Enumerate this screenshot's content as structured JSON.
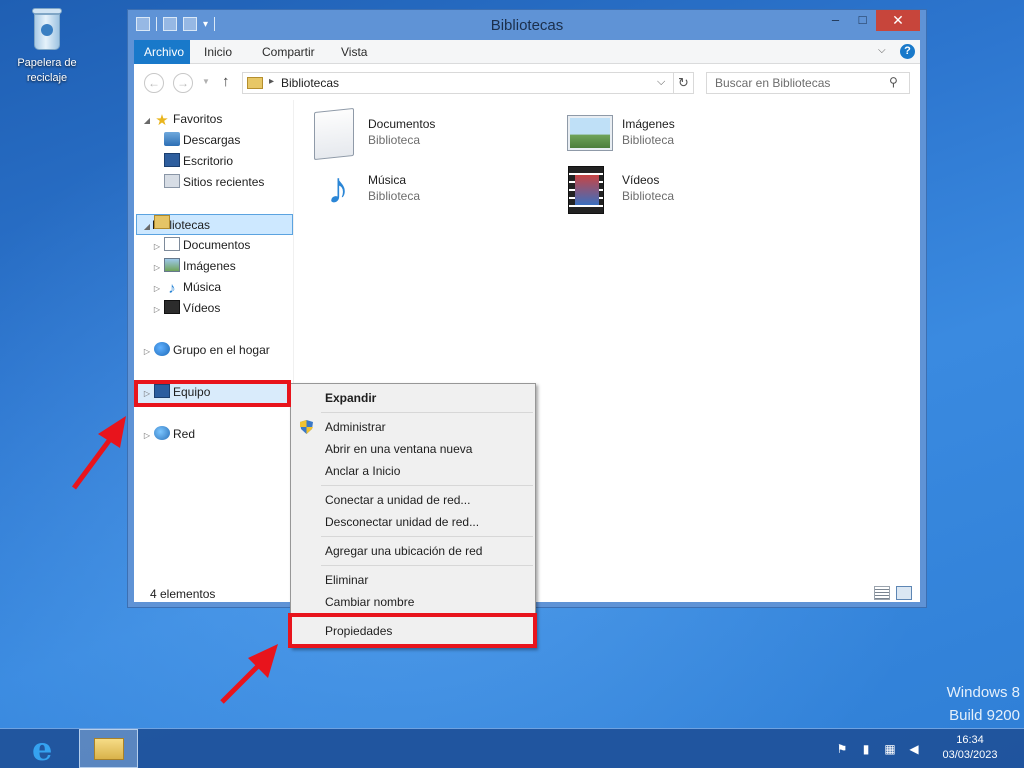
{
  "desktop": {
    "recycle_bin_label": "Papelera de reciclaje",
    "watermark_line1": "Windows 8",
    "watermark_line2": "Build 9200"
  },
  "window": {
    "title": "Bibliotecas",
    "controls": {
      "minimize": "–",
      "maximize": "□",
      "close": "✕"
    }
  },
  "ribbon": {
    "tabs": [
      "Archivo",
      "Inicio",
      "Compartir",
      "Vista"
    ],
    "expand_icon": "chevron-down-icon",
    "help_label": "?"
  },
  "address_bar": {
    "back": "←",
    "forward": "→",
    "up": "↑",
    "path": "Bibliotecas",
    "search_placeholder": "Buscar en Bibliotecas"
  },
  "nav_pane": {
    "favorites": {
      "label": "Favoritos",
      "items": [
        "Descargas",
        "Escritorio",
        "Sitios recientes"
      ]
    },
    "libraries": {
      "label": "Bibliotecas",
      "items": [
        "Documentos",
        "Imágenes",
        "Música",
        "Vídeos"
      ]
    },
    "homegroup": "Grupo en el hogar",
    "computer": "Equipo",
    "network": "Red"
  },
  "libraries": [
    {
      "name": "Documentos",
      "type": "Biblioteca",
      "icon": "documents-library-icon"
    },
    {
      "name": "Imágenes",
      "type": "Biblioteca",
      "icon": "pictures-library-icon"
    },
    {
      "name": "Música",
      "type": "Biblioteca",
      "icon": "music-library-icon"
    },
    {
      "name": "Vídeos",
      "type": "Biblioteca",
      "icon": "videos-library-icon"
    }
  ],
  "status": {
    "count": "4 elementos"
  },
  "context_menu": {
    "items": [
      "Expandir",
      "Administrar",
      "Abrir en una ventana nueva",
      "Anclar a Inicio",
      "Conectar a unidad de red...",
      "Desconectar unidad de red...",
      "Agregar una ubicación de red",
      "Eliminar",
      "Cambiar nombre",
      "Propiedades"
    ]
  },
  "annotations": {
    "color": "#e8141c"
  },
  "taskbar": {
    "time": "16:34",
    "date": "03/03/2023",
    "accent": "#1e4e96"
  }
}
